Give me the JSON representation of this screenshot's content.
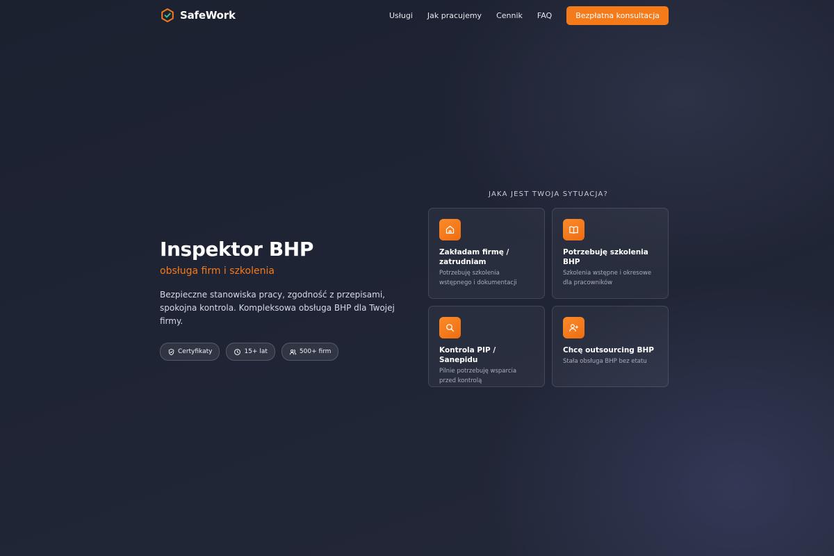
{
  "brand": {
    "name": "SafeWork",
    "accent_color": "#f57a19"
  },
  "nav": {
    "links": [
      "Usługi",
      "Jak pracujemy",
      "Cennik",
      "FAQ"
    ],
    "cta_label": "Bezpłatna konsultacja"
  },
  "hero": {
    "title": "Inspektor BHP",
    "subtitle": "obsługa firm i szkolenia",
    "description": "Bezpieczne stanowiska pracy, zgodność z przepisami, spokojna kontrola. Kompleksowa obsługa BHP dla Twojej firmy.",
    "badges": [
      {
        "label": "Certyfikaty",
        "icon": "shield-check-icon"
      },
      {
        "label": "15+ lat",
        "icon": "clock-icon"
      },
      {
        "label": "500+ firm",
        "icon": "users-icon"
      }
    ]
  },
  "situations": {
    "heading": "JAKA JEST TWOJA SYTUACJA?",
    "cards": [
      {
        "title": "Zakładam firmę / zatrudniam",
        "description": "Potrzebuję szkolenia wstępnego i dokumentacji",
        "icon": "building-icon"
      },
      {
        "title": "Potrzebuję szkolenia BHP",
        "description": "Szkolenia wstępne i okresowe dla pracowników",
        "icon": "book-icon"
      },
      {
        "title": "Kontrola PIP / Sanepidu",
        "description": "Pilnie potrzebuję wsparcia przed kontrolą",
        "icon": "search-icon"
      },
      {
        "title": "Chcę outsourcing BHP",
        "description": "Stała obsługa BHP bez etatu",
        "icon": "user-plus-icon"
      }
    ]
  }
}
